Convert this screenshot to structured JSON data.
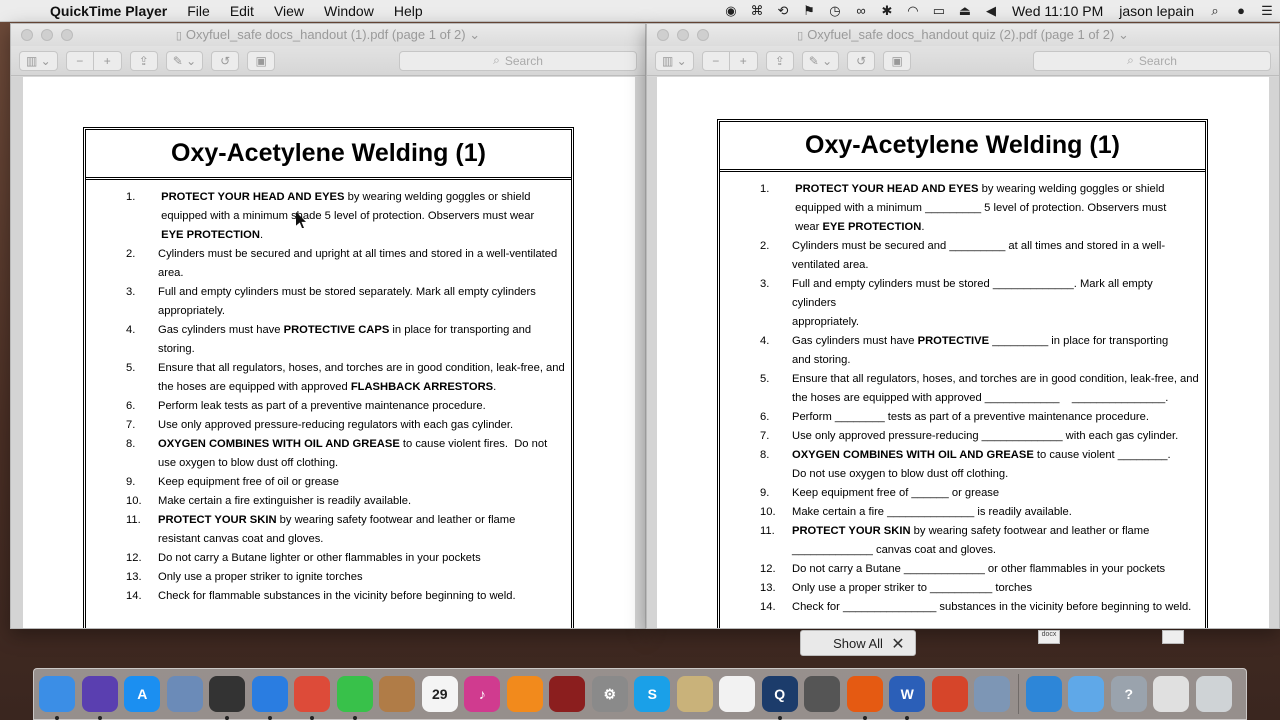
{
  "menubar": {
    "app": "QuickTime Player",
    "menus": [
      "File",
      "Edit",
      "View",
      "Window",
      "Help"
    ],
    "clock": "Wed 11:10 PM",
    "user": "jason lepain"
  },
  "windows": {
    "left": {
      "title": "Oxyfuel_safe docs_handout (1).pdf (page 1 of 2)",
      "search_placeholder": "Search",
      "doc_title": "Oxy-Acetylene Welding (1)"
    },
    "right": {
      "title": "Oxyfuel_safe docs_handout quiz (2).pdf (page 1 of 2)",
      "search_placeholder": "Search",
      "doc_title": "Oxy-Acetylene Welding (1)"
    }
  },
  "stack": {
    "show_all": "Show All",
    "close": "✕",
    "peek_label": "docx"
  },
  "dock": {
    "items": [
      {
        "name": "finder-icon",
        "label": "",
        "color": "#3b8ee6"
      },
      {
        "name": "siri-icon",
        "label": "",
        "color": "#5a3fb0"
      },
      {
        "name": "app-store-icon",
        "label": "A",
        "color": "#1b8ff1"
      },
      {
        "name": "preview-bird-icon",
        "label": "",
        "color": "#6b8bb8"
      },
      {
        "name": "photo-booth-icon",
        "label": "",
        "color": "#333333"
      },
      {
        "name": "safari-icon",
        "label": "",
        "color": "#2a7de1"
      },
      {
        "name": "chrome-icon",
        "label": "",
        "color": "#dd4b39"
      },
      {
        "name": "messages-icon",
        "label": "",
        "color": "#38c14a"
      },
      {
        "name": "contacts-icon",
        "label": "",
        "color": "#b07c47"
      },
      {
        "name": "calendar-icon",
        "label": "29",
        "color": "#f4f4f4"
      },
      {
        "name": "itunes-icon",
        "label": "♪",
        "color": "#d03b8f"
      },
      {
        "name": "ibooks-icon",
        "label": "",
        "color": "#f28a1c"
      },
      {
        "name": "photo-slideshow-icon",
        "label": "",
        "color": "#8b1e1e"
      },
      {
        "name": "system-preferences-icon",
        "label": "⚙",
        "color": "#8a8a8a"
      },
      {
        "name": "skype-icon",
        "label": "S",
        "color": "#1aa0e8"
      },
      {
        "name": "preview-icon",
        "label": "",
        "color": "#c9b27a"
      },
      {
        "name": "photos-icon",
        "label": "",
        "color": "#f2f2f2"
      },
      {
        "name": "quicktime-icon",
        "label": "Q",
        "color": "#1c3c6b"
      },
      {
        "name": "printer-icon",
        "label": "",
        "color": "#555555"
      },
      {
        "name": "flame-app-icon",
        "label": "",
        "color": "#e55a12"
      },
      {
        "name": "word-icon",
        "label": "W",
        "color": "#2b5fb8"
      },
      {
        "name": "office-icon",
        "label": "",
        "color": "#d6452a"
      },
      {
        "name": "image-capture-icon",
        "label": "",
        "color": "#7d96b5"
      },
      {
        "name": "network-globe-icon",
        "label": "",
        "color": "#2d86d8"
      },
      {
        "name": "applications-folder-icon",
        "label": "",
        "color": "#5fa8e8"
      },
      {
        "name": "help-icon",
        "label": "?",
        "color": "#9aa3ad"
      },
      {
        "name": "pdf-document-icon",
        "label": "",
        "color": "#e0e0e0"
      },
      {
        "name": "trash-icon",
        "label": "",
        "color": "#cfd3d6"
      }
    ]
  }
}
